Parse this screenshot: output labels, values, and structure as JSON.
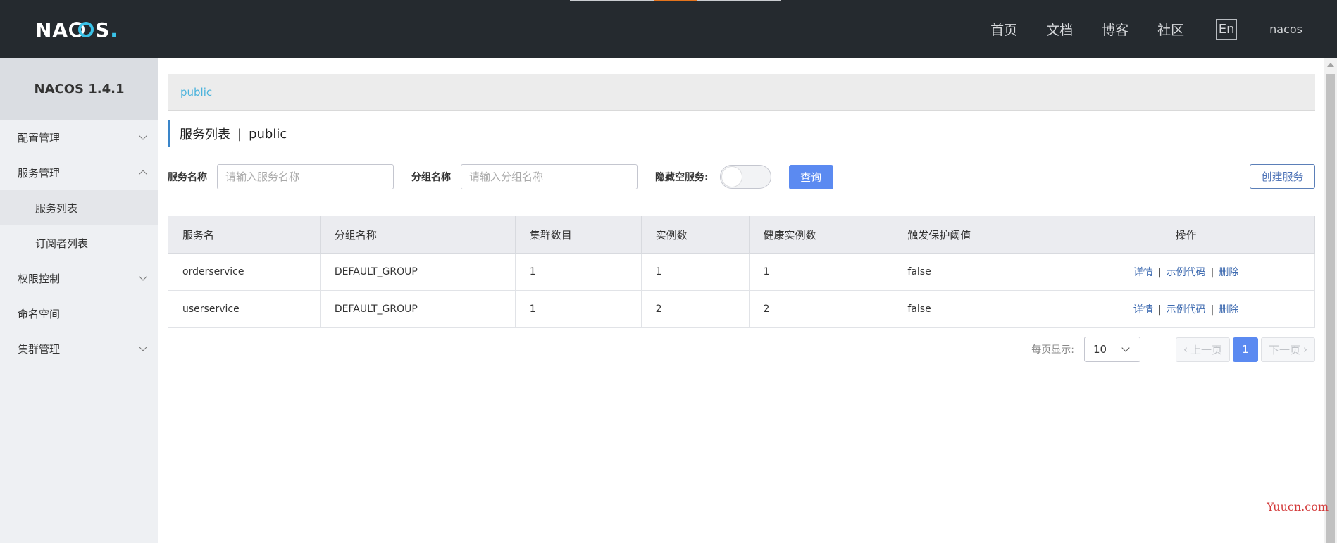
{
  "header": {
    "logo": "NACOS.",
    "nav": [
      "首页",
      "文档",
      "博客",
      "社区"
    ],
    "lang": "En",
    "user": "nacos"
  },
  "sidebar": {
    "title": "NACOS 1.4.1",
    "items": [
      {
        "label": "配置管理",
        "chevron": "down"
      },
      {
        "label": "服务管理",
        "chevron": "up"
      },
      {
        "label": "服务列表",
        "sub": true,
        "active": true
      },
      {
        "label": "订阅者列表",
        "sub": true
      },
      {
        "label": "权限控制",
        "chevron": "down"
      },
      {
        "label": "命名空间"
      },
      {
        "label": "集群管理",
        "chevron": "down"
      }
    ]
  },
  "namespace_bar": {
    "label": "public"
  },
  "page_title": {
    "main": "服务列表",
    "sep": "|",
    "ns": "public"
  },
  "filter": {
    "service_name_label": "服务名称",
    "service_name_placeholder": "请输入服务名称",
    "group_name_label": "分组名称",
    "group_name_placeholder": "请输入分组名称",
    "hide_empty_label": "隐藏空服务:",
    "query_button": "查询",
    "create_button": "创建服务"
  },
  "table": {
    "columns": [
      "服务名",
      "分组名称",
      "集群数目",
      "实例数",
      "健康实例数",
      "触发保护阈值",
      "操作"
    ],
    "rows": [
      {
        "name": "orderservice",
        "group": "DEFAULT_GROUP",
        "clusters": "1",
        "instances": "1",
        "healthy": "1",
        "threshold": "false"
      },
      {
        "name": "userservice",
        "group": "DEFAULT_GROUP",
        "clusters": "1",
        "instances": "2",
        "healthy": "2",
        "threshold": "false"
      }
    ],
    "actions": {
      "detail": "详情",
      "sample": "示例代码",
      "delete": "删除",
      "sep": "|"
    }
  },
  "pagination": {
    "per_page_label": "每页显示:",
    "page_size": "10",
    "prev": "上一页",
    "current": "1",
    "next": "下一页"
  },
  "watermark": "Yuucn.com",
  "colors": {
    "topbar": "#252a2f",
    "primary": "#5b8af1",
    "link": "#3d6ab0",
    "ns_text": "#4bb3dc"
  }
}
